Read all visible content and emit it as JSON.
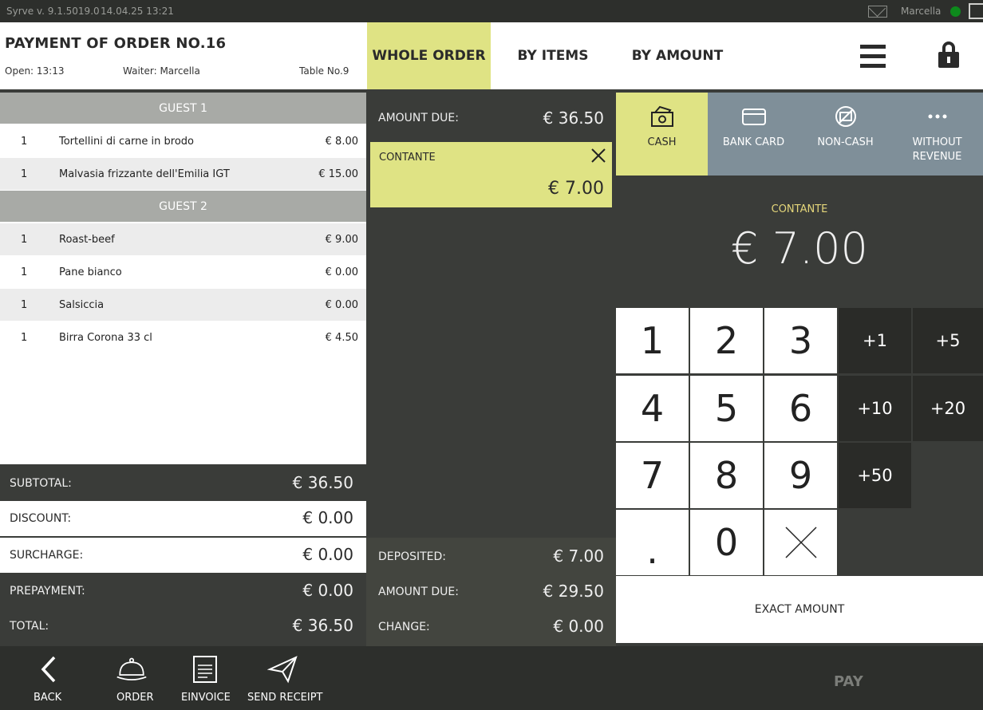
{
  "status": {
    "version": "Syrve  v. 9.1.5019.0",
    "datetime": "14.04.25   13:21",
    "user": "Marcella"
  },
  "order": {
    "title": "PAYMENT OF ORDER NO.16",
    "open": "Open: 13:13",
    "waiter": "Waiter: Marcella",
    "table": "Table No.9"
  },
  "tabs": [
    "WHOLE ORDER",
    "BY ITEMS",
    "BY AMOUNT"
  ],
  "guests": [
    {
      "label": "GUEST 1",
      "items": [
        {
          "qty": "1",
          "name": "Tortellini di carne in brodo",
          "price": "€ 8.00"
        },
        {
          "qty": "1",
          "name": "Malvasia frizzante dell'Emilia IGT",
          "price": "€ 15.00"
        }
      ]
    },
    {
      "label": "GUEST 2",
      "items": [
        {
          "qty": "1",
          "name": "Roast-beef",
          "price": "€ 9.00"
        },
        {
          "qty": "1",
          "name": "Pane bianco",
          "price": "€ 0.00"
        },
        {
          "qty": "1",
          "name": "Salsiccia",
          "price": "€ 0.00"
        },
        {
          "qty": "1",
          "name": "Birra Corona 33 cl",
          "price": "€ 4.50"
        }
      ]
    }
  ],
  "totals": {
    "subtotal_label": "SUBTOTAL:",
    "subtotal": "€ 36.50",
    "discount_label": "DISCOUNT:",
    "discount": "€ 0.00",
    "surcharge_label": "SURCHARGE:",
    "surcharge": "€ 0.00",
    "prepayment_label": "PREPAYMENT:",
    "prepayment": "€ 0.00",
    "total_label": "TOTAL:",
    "total": "€ 36.50"
  },
  "middle": {
    "amount_due_label": "AMOUNT DUE:",
    "amount_due": "€ 36.50",
    "payment_label": "CONTANTE",
    "payment_amount": "€ 7.00",
    "deposited_label": "DEPOSITED:",
    "deposited": "€ 7.00",
    "remaining_label": "AMOUNT DUE:",
    "remaining": "€ 29.50",
    "change_label": "CHANGE:",
    "change": "€ 0.00"
  },
  "paytypes": [
    {
      "label": "CASH",
      "icon": "cash-icon"
    },
    {
      "label": "BANK CARD",
      "icon": "bank-card-icon"
    },
    {
      "label": "NON-CASH",
      "icon": "non-cash-icon"
    },
    {
      "label": "WITHOUT REVENUE",
      "icon": "more-dots-icon"
    }
  ],
  "display": {
    "label": "CONTANTE",
    "amount": "€ 7.00"
  },
  "keypad": {
    "digits": [
      "1",
      "2",
      "3",
      "4",
      "5",
      "6",
      "7",
      "8",
      "9",
      ".",
      "0"
    ],
    "quick": [
      "+1",
      "+5",
      "+10",
      "+20",
      "+50"
    ],
    "exact": "EXACT AMOUNT"
  },
  "bottom": {
    "back": "BACK",
    "order": "ORDER",
    "einvoice": "EINVOICE",
    "send_receipt": "SEND RECEIPT",
    "pay": "PAY"
  },
  "colors": {
    "accent": "#dfe384",
    "paytype_bg": "#7f8f99",
    "dark_bg": "#3a3c39",
    "status_green": "#0d8a1c"
  }
}
